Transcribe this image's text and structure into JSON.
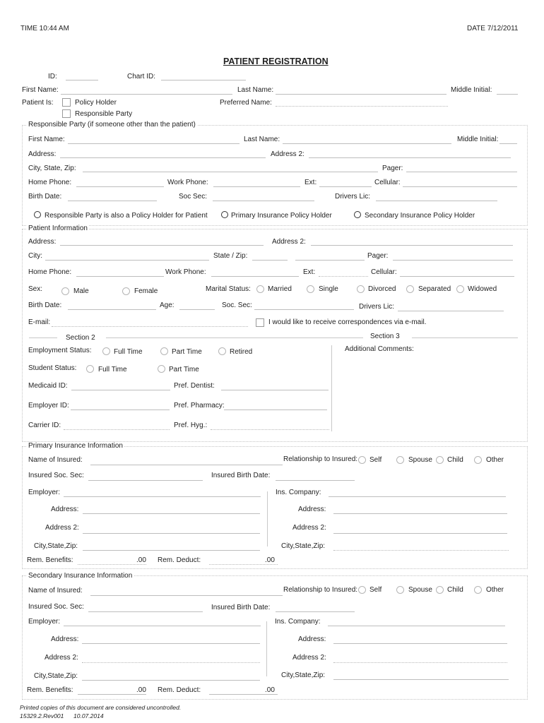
{
  "header": {
    "time": "TIME 10:44 AM",
    "date": "DATE 7/12/2011",
    "title": "PATIENT REGISTRATION"
  },
  "top": {
    "id_label": "ID:",
    "chart_id_label": "Chart ID:",
    "first_name_label": "First Name:",
    "last_name_label": "Last Name:",
    "middle_initial_label": "Middle Initial:",
    "patient_is_label": "Patient Is:",
    "policy_holder_label": "Policy Holder",
    "responsible_party_label": "Responsible Party",
    "preferred_name_label": "Preferred Name:"
  },
  "responsible": {
    "legend": "Responsible Party (if someone other than the patient)",
    "first_name": "First Name:",
    "last_name": "Last Name:",
    "middle_initial": "Middle Initial:",
    "address": "Address:",
    "address2": "Address 2:",
    "city_state_zip": "City, State, Zip:",
    "pager": "Pager:",
    "home_phone": "Home Phone:",
    "work_phone": "Work Phone:",
    "ext": "Ext:",
    "cellular": "Cellular:",
    "birth_date": "Birth Date:",
    "soc_sec": "Soc Sec:",
    "drivers_lic": "Drivers Lic:",
    "options": [
      "Responsible Party is also a Policy Holder for Patient",
      "Primary Insurance Policy Holder",
      "Secondary Insurance Policy Holder"
    ]
  },
  "patient": {
    "legend": "Patient Information",
    "address": "Address:",
    "address2": "Address 2:",
    "city": "City:",
    "state_zip": "State / Zip:",
    "pager": "Pager:",
    "home_phone": "Home Phone:",
    "work_phone": "Work Phone:",
    "ext": "Ext:",
    "cellular": "Cellular:",
    "sex_label": "Sex:",
    "sex_options": [
      "Male",
      "Female"
    ],
    "marital_label": "Marital Status:",
    "marital_options": [
      "Married",
      "Single",
      "Divorced",
      "Separated",
      "Widowed"
    ],
    "birth_date": "Birth Date:",
    "age": "Age:",
    "soc_sec": "Soc. Sec:",
    "drivers_lic": "Drivers Lic:",
    "email": "E-mail:",
    "email_opt_in": "I would like to receive correspondences via e-mail.",
    "section2": "Section 2",
    "section3": "Section 3",
    "employment_label": "Employment Status:",
    "employment_options": [
      "Full Time",
      "Part Time",
      "Retired"
    ],
    "student_label": "Student Status:",
    "student_options": [
      "Full Time",
      "Part Time"
    ],
    "medicaid_id": "Medicaid ID:",
    "pref_dentist": "Pref. Dentist:",
    "employer_id": "Employer ID:",
    "pref_pharmacy": "Pref. Pharmacy:",
    "carrier_id": "Carrier ID:",
    "pref_hyg": "Pref. Hyg.:",
    "additional_comments": "Additional Comments:"
  },
  "primary": {
    "legend": "Primary Insurance Information",
    "name_of_insured": "Name of Insured:",
    "relationship": "Relationship to Insured:",
    "relationship_options": [
      "Self",
      "Spouse",
      "Child",
      "Other"
    ],
    "insured_soc_sec": "Insured Soc. Sec:",
    "insured_birth_date": "Insured Birth Date:",
    "employer": "Employer:",
    "ins_company": "Ins. Company:",
    "address": "Address:",
    "address2": "Address 2:",
    "city_state_zip": "City,State,Zip:",
    "rem_benefits": "Rem. Benefits:",
    "rem_benefits_value": ".00",
    "rem_deduct": "Rem. Deduct:",
    "rem_deduct_value": ".00"
  },
  "secondary": {
    "legend": "Secondary Insurance Information",
    "name_of_insured": "Name of Insured:",
    "relationship": "Relationship to Insured:",
    "relationship_options": [
      "Self",
      "Spouse",
      "Child",
      "Other"
    ],
    "insured_soc_sec": "Insured Soc. Sec:",
    "insured_birth_date": "Insured Birth Date:",
    "employer": "Employer:",
    "ins_company": "Ins. Company:",
    "address": "Address:",
    "address2": "Address 2:",
    "city_state_zip": "City,State,Zip:",
    "rem_benefits": "Rem. Benefits:",
    "rem_benefits_value": ".00",
    "rem_deduct": "Rem. Deduct:",
    "rem_deduct_value": ".00"
  },
  "footer": {
    "disclaimer": "Printed copies of this document are considered uncontrolled.",
    "doc_id": "15329.2.Rev001",
    "doc_date": "10.07.2014"
  }
}
